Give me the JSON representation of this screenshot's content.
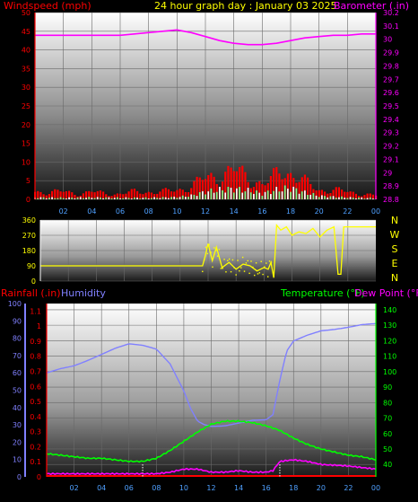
{
  "title": "24 hour graph day : January 03 2025",
  "colors": {
    "wind_label": "#ff0000",
    "baro_label": "#ff00ff",
    "title": "#ffff00",
    "rain_label": "#ff0000",
    "humidity": "#8080ff",
    "temperature": "#00ff00",
    "dewpoint": "#ff00ff",
    "wind_dir": "#ffff00",
    "wind_gust": "#ff0000",
    "wind_avg": "#ffffff",
    "wind_avg_green": "#7cfc8a",
    "baro_line": "#ff00ff"
  },
  "chart_data": [
    {
      "id": "wind_baro",
      "type": "line",
      "left_label": "Windspeed (mph)",
      "right_label": "Barometer (.in)",
      "x_ticks": [
        "02",
        "04",
        "06",
        "08",
        "10",
        "12",
        "14",
        "16",
        "18",
        "20",
        "22",
        "00"
      ],
      "y_left": {
        "ticks": [
          "0",
          "5",
          "10",
          "15",
          "20",
          "25",
          "30",
          "35",
          "40",
          "45",
          "50"
        ],
        "lim": [
          0,
          50
        ]
      },
      "y_right": {
        "ticks": [
          "28.8",
          "28.9",
          "29",
          "29.1",
          "29.2",
          "29.3",
          "29.4",
          "29.5",
          "29.6",
          "29.7",
          "29.8",
          "29.9",
          "30",
          "30.1",
          "30.2"
        ],
        "lim": [
          28.8,
          30.2
        ]
      },
      "barometer": {
        "hours": [
          0,
          2,
          4,
          6,
          8,
          9,
          10,
          11,
          12,
          13,
          14,
          15,
          16,
          17,
          18,
          19,
          20,
          21,
          22,
          23,
          24
        ],
        "values": [
          30.03,
          30.03,
          30.03,
          30.03,
          30.05,
          30.06,
          30.07,
          30.05,
          30.02,
          29.99,
          29.97,
          29.96,
          29.96,
          29.97,
          29.99,
          30.01,
          30.02,
          30.03,
          30.03,
          30.04,
          30.04
        ]
      },
      "gust": {
        "hours": [
          0,
          1,
          2,
          3,
          4,
          5,
          6,
          7,
          8,
          9,
          10,
          11,
          12,
          13,
          14,
          15,
          16,
          16.5,
          17,
          17.5,
          18,
          19,
          20,
          21,
          22,
          23,
          24
        ],
        "values": [
          2.0,
          2.0,
          2.0,
          1.5,
          2.0,
          1.5,
          1.5,
          2.0,
          2.0,
          2.0,
          2.5,
          3.5,
          5.5,
          6.5,
          7.5,
          6.0,
          4.0,
          4.5,
          6.5,
          8.5,
          7.0,
          4.5,
          2.5,
          2.5,
          2.0,
          1.5,
          1.0
        ]
      },
      "average": {
        "hours": [
          0,
          2,
          4,
          6,
          8,
          10,
          11,
          12,
          13,
          14,
          15,
          16,
          17,
          18,
          19,
          20,
          22,
          24
        ],
        "values": [
          0.5,
          0.4,
          0.5,
          0.4,
          0.4,
          0.6,
          1.0,
          2.0,
          2.5,
          2.8,
          2.3,
          1.5,
          2.5,
          3.0,
          1.8,
          0.9,
          0.5,
          0.3
        ]
      }
    },
    {
      "id": "wind_direction",
      "type": "scatter",
      "y_ticks": [
        "0",
        "90",
        "180",
        "270",
        "360"
      ],
      "y_lim": [
        0,
        360
      ],
      "compass": [
        "N",
        "W",
        "S",
        "E",
        "N"
      ],
      "hours": [
        0,
        2,
        4,
        6,
        8,
        10,
        10.8,
        11.6,
        11.8,
        12,
        12.3,
        12.6,
        13,
        13.5,
        14,
        14.5,
        15,
        15.5,
        16,
        16.3,
        16.5,
        16.7,
        16.9,
        17.2,
        17.6,
        18,
        18.5,
        19,
        19.5,
        20,
        20.5,
        21,
        21.3,
        21.5,
        21.7,
        22,
        23,
        24
      ],
      "values": [
        90,
        90,
        90,
        90,
        90,
        90,
        90,
        90,
        150,
        220,
        120,
        200,
        80,
        110,
        70,
        100,
        90,
        60,
        80,
        70,
        110,
        20,
        330,
        300,
        320,
        270,
        290,
        280,
        310,
        260,
        300,
        320,
        40,
        40,
        320,
        320,
        320,
        320
      ]
    },
    {
      "id": "rain_humidity_temp",
      "type": "line",
      "left_label": "Rainfall (.in)",
      "humidity_label": "Humidity",
      "right_label": "Temperature (°F)",
      "dew_label": "Dew Point (°F)",
      "y_humidity": {
        "ticks": [
          "0",
          "10",
          "20",
          "30",
          "40",
          "50",
          "60",
          "70",
          "80",
          "90",
          "100"
        ],
        "lim": [
          0,
          100
        ]
      },
      "y_rain": {
        "ticks": [
          "0",
          "0.1",
          "0.2",
          "0.3",
          "0.4",
          "0.5",
          "0.6",
          "0.7",
          "0.8",
          "0.9",
          "1",
          "1.1"
        ],
        "lim": [
          0,
          1.15
        ]
      },
      "y_temp": {
        "ticks": [
          "40",
          "50",
          "60",
          "70",
          "80",
          "90",
          "100",
          "110",
          "120",
          "130",
          "140"
        ],
        "lim": [
          32,
          144
        ]
      },
      "humidity": {
        "hours": [
          0,
          1,
          2,
          3,
          4,
          5,
          6,
          7,
          8,
          9,
          10,
          10.5,
          11,
          11.5,
          12,
          13,
          14,
          15,
          16,
          16.5,
          17,
          17.5,
          18,
          19,
          20,
          21,
          22,
          23,
          24
        ],
        "values": [
          60,
          63,
          65,
          68,
          71,
          74,
          76,
          75,
          73,
          65,
          50,
          40,
          33,
          31,
          30,
          30,
          31,
          32,
          32,
          35,
          55,
          72,
          78,
          82,
          85,
          86,
          87,
          88,
          88
        ]
      },
      "temperature": {
        "hours": [
          0,
          1,
          2,
          3,
          4,
          5,
          6,
          7,
          8,
          9,
          10,
          11,
          12,
          13,
          14,
          15,
          16,
          17,
          18,
          19,
          20,
          21,
          22,
          23,
          24
        ],
        "values": [
          47,
          46,
          45,
          44,
          44,
          43,
          42,
          42,
          44,
          49,
          55,
          61,
          66,
          68,
          68,
          67,
          65,
          62,
          57,
          53,
          50,
          48,
          46,
          45,
          43
        ]
      },
      "dewpoint": {
        "hours": [
          0,
          2,
          4,
          6,
          8,
          9,
          10,
          11,
          12,
          13,
          14,
          15,
          16,
          16.5,
          17,
          18,
          19,
          20,
          22,
          24
        ],
        "values": [
          34,
          34,
          34,
          34,
          34,
          35,
          37,
          37,
          35,
          35,
          36,
          35,
          35,
          36,
          42,
          43,
          42,
          40,
          39,
          37
        ]
      },
      "rain_markers_hours": [
        7.0,
        17.0
      ]
    }
  ]
}
